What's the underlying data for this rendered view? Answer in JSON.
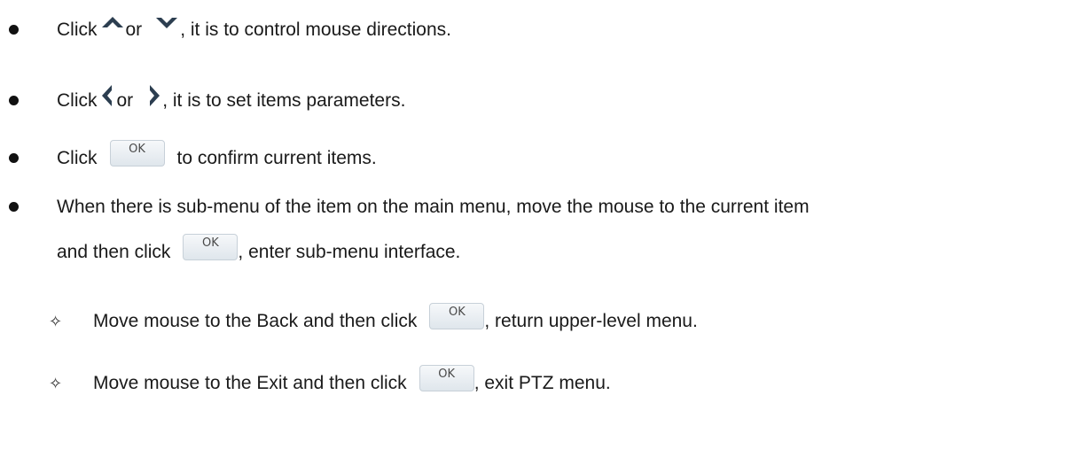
{
  "items": [
    {
      "pre": "Click",
      "mid": "or",
      "post": ", it is to control mouse directions.",
      "icons": [
        "chevron-up-icon",
        "chevron-down-icon"
      ]
    },
    {
      "pre": "Click",
      "mid": "or",
      "post": ", it is to set items parameters.",
      "icons": [
        "chevron-left-icon",
        "chevron-right-icon"
      ]
    },
    {
      "pre": "Click",
      "post": "to confirm current items.",
      "icons": [
        "ok-button-icon"
      ]
    },
    {
      "line1": "When there is sub-menu of the item on the main menu, move the mouse to the current item",
      "line2_pre": "and then click",
      "line2_post": ", enter sub-menu interface.",
      "icons": [
        "ok-button-icon"
      ]
    }
  ],
  "subitems": [
    {
      "marker": "✧",
      "pre": "Move mouse to the Back and then click",
      "post": ", return upper-level menu.",
      "icons": [
        "ok-button-icon"
      ]
    },
    {
      "marker": "✧",
      "pre": "Move mouse to the Exit and then click",
      "post": ", exit PTZ menu.",
      "icons": [
        "ok-button-icon"
      ]
    }
  ],
  "ok_label": "OK",
  "colors": {
    "text": "#1a1a1a",
    "arrow": "#2c3e50",
    "ok_bg": "#e8edf1"
  }
}
